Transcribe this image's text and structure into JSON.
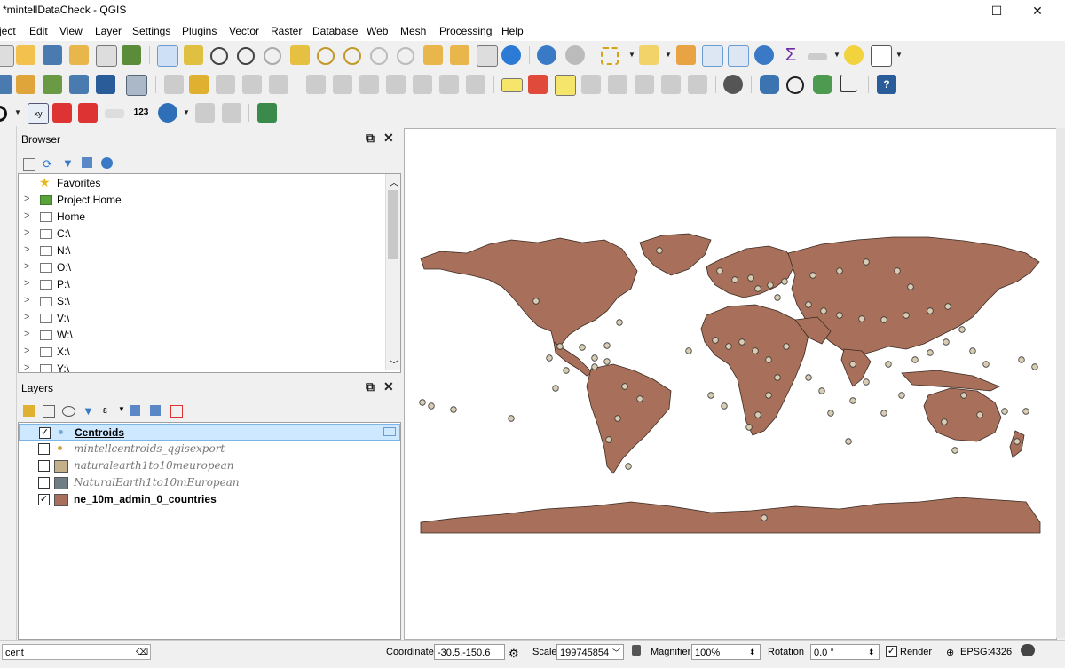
{
  "window": {
    "title": "*mintellDataCheck - QGIS",
    "min": "–",
    "max": "☐",
    "close": "✕"
  },
  "menu": [
    "ject",
    "Edit",
    "View",
    "Layer",
    "Settings",
    "Plugins",
    "Vector",
    "Raster",
    "Database",
    "Web",
    "Mesh",
    "Processing",
    "Help"
  ],
  "browser": {
    "title": "Browser",
    "items": [
      "Favorites",
      "Project Home",
      "Home",
      "C:\\",
      "N:\\",
      "O:\\",
      "P:\\",
      "S:\\",
      "V:\\",
      "W:\\",
      "X:\\",
      "Y:\\"
    ]
  },
  "layers": {
    "title": "Layers",
    "items": [
      {
        "name": "Centroids",
        "checked": true
      },
      {
        "name": "mintellcentroids_qgisexport",
        "checked": false
      },
      {
        "name": "naturalearth1to10meuropean",
        "checked": false
      },
      {
        "name": "NaturalEarth1to10mEuropean",
        "checked": false
      },
      {
        "name": "ne_10m_admin_0_countries",
        "checked": true
      }
    ]
  },
  "colors": {
    "land": "#a8705a",
    "point_fill": "#d8ccb2",
    "tan_symbol": "#c4b08a",
    "grey_symbol": "#6f7e84",
    "selection": "#cde8ff"
  },
  "status": {
    "search_value": "cent",
    "coordinate_label": "Coordinate",
    "coordinate_value": "-30.5,-150.6",
    "scale_label": "Scale",
    "scale_value": "199745854",
    "magnifier_label": "Magnifier",
    "magnifier_value": "100%",
    "rotation_label": "Rotation",
    "rotation_value": "0.0 °",
    "render_label": "Render",
    "crs": "EPSG:4326"
  },
  "icons": [
    "pan-icon",
    "zoom-in-icon",
    "zoom-out-icon",
    "identify-icon",
    "select-icon",
    "python-icon",
    "help-icon",
    "label-icon",
    "sum-icon",
    "measure-icon"
  ]
}
